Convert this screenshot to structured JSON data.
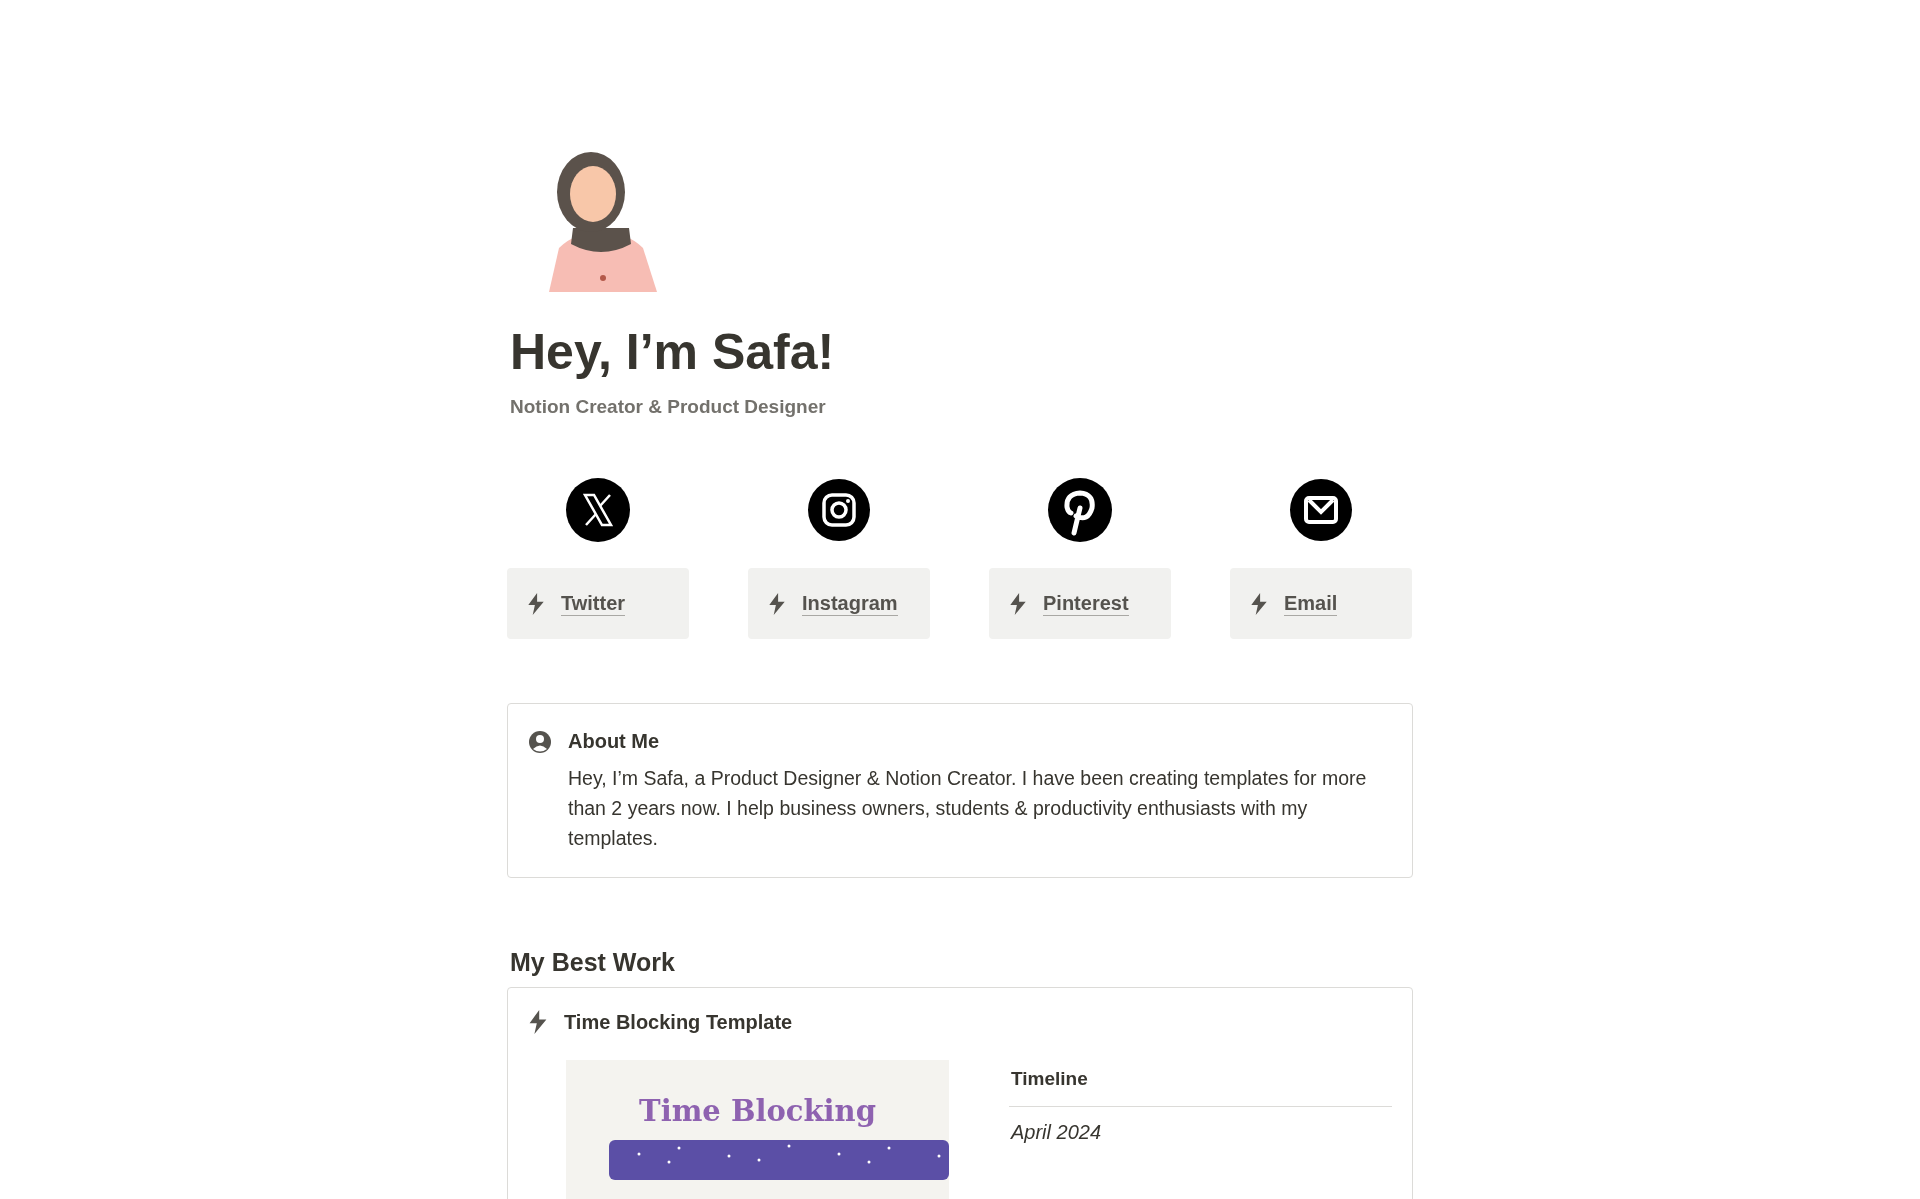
{
  "profile": {
    "name": "Hey, I’m Safa!",
    "tagline": "Notion Creator & Product Designer"
  },
  "socials": [
    {
      "kind": "x",
      "label": "Twitter"
    },
    {
      "kind": "instagram",
      "label": "Instagram"
    },
    {
      "kind": "pinterest",
      "label": "Pinterest"
    },
    {
      "kind": "mail",
      "label": "Email"
    }
  ],
  "about": {
    "title": "About Me",
    "text": "Hey, I’m Safa, a Product Designer & Notion Creator. I have been creating templates for more than 2 years now. I help business owners, students & productivity enthusiasts with my templates."
  },
  "best_work": {
    "heading": "My Best Work",
    "items": [
      {
        "title": "Time Blocking Template",
        "preview_title": "Time Blocking",
        "property": "Timeline",
        "value": "April 2024"
      }
    ]
  }
}
